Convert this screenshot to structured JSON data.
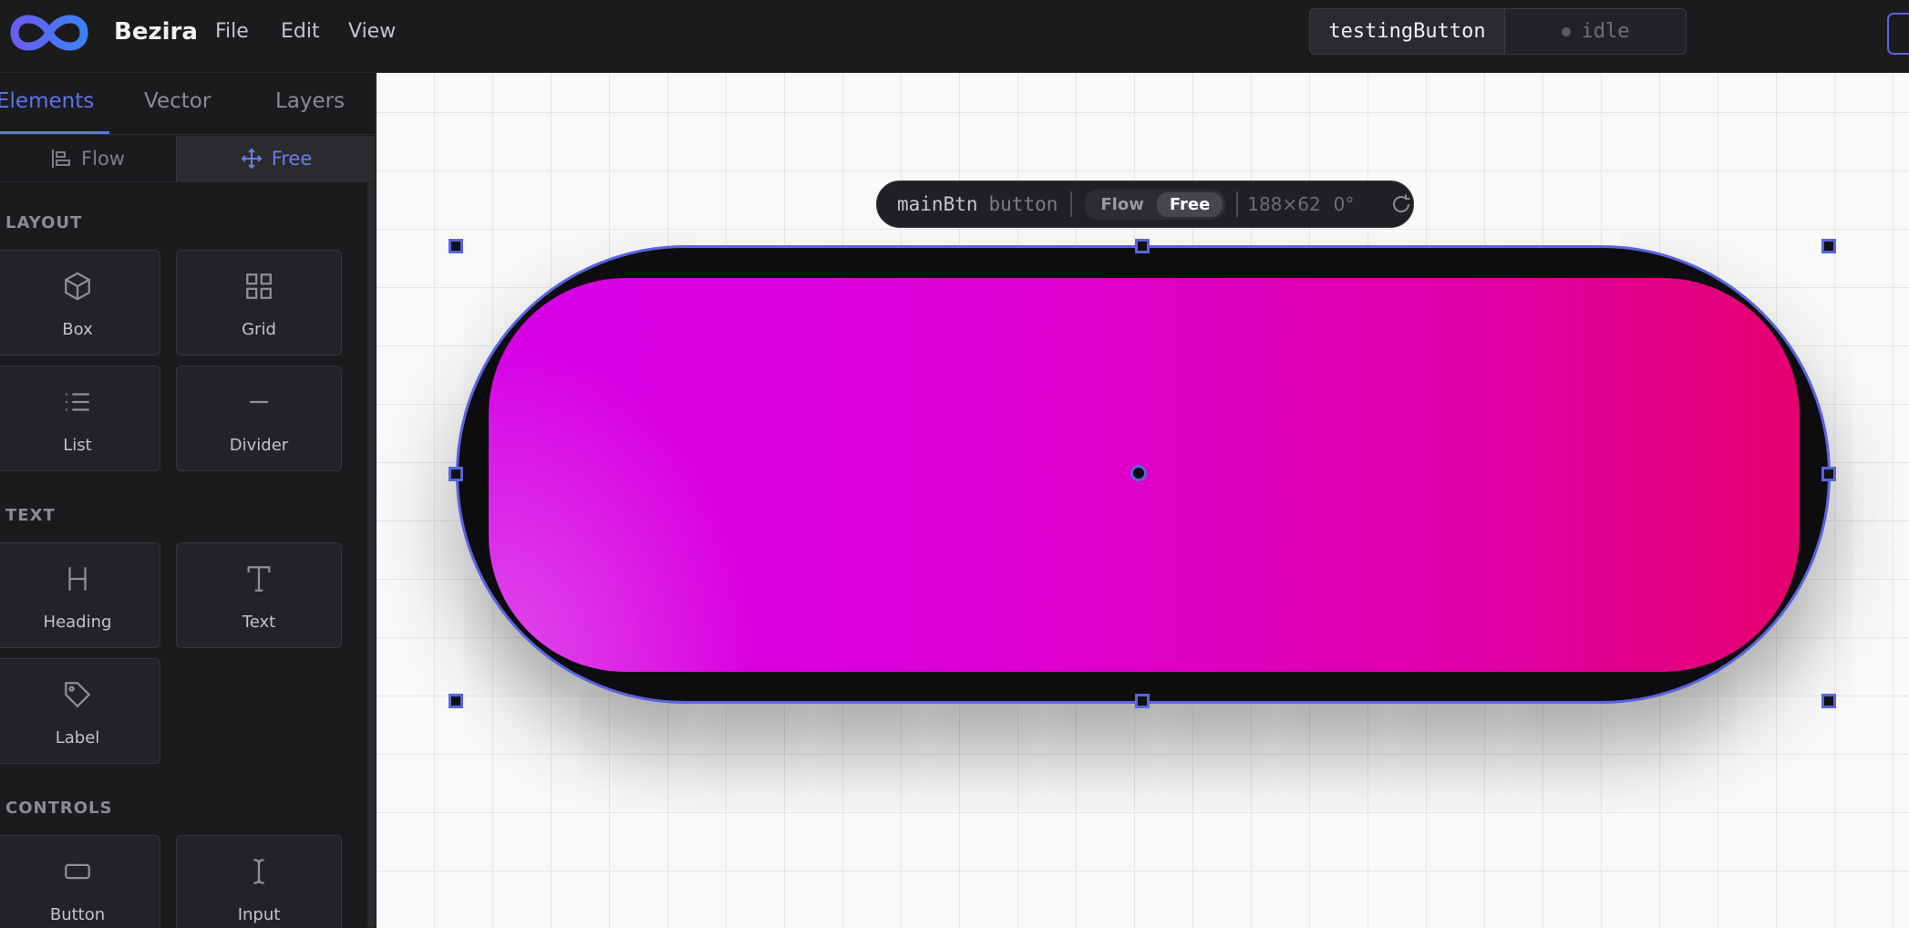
{
  "app": {
    "brand": "Bezira",
    "menu": {
      "file": "File",
      "edit": "Edit",
      "view": "View"
    }
  },
  "header": {
    "component_name": "testingButton",
    "status": "idle"
  },
  "sidebar": {
    "tabs": {
      "elements": "Elements",
      "vector": "Vector",
      "layers": "Layers"
    },
    "mode": {
      "flow": "Flow",
      "free": "Free"
    },
    "sections": {
      "layout": {
        "title": "LAYOUT",
        "items": {
          "box": "Box",
          "grid": "Grid",
          "list": "List",
          "divider": "Divider"
        }
      },
      "text": {
        "title": "TEXT",
        "items": {
          "heading": "Heading",
          "text": "Text",
          "label": "Label"
        }
      },
      "controls": {
        "title": "CONTROLS",
        "items": {
          "button": "Button",
          "input": "Input"
        }
      }
    }
  },
  "canvas": {
    "toolbar": {
      "element_name": "mainBtn",
      "element_type": "button",
      "flow": "Flow",
      "free": "Free",
      "size": "188×62",
      "rotation": "0°"
    }
  },
  "colors": {
    "accent": "#5a63e0",
    "button_start": "#d600e6",
    "button_end": "#e4006e"
  }
}
